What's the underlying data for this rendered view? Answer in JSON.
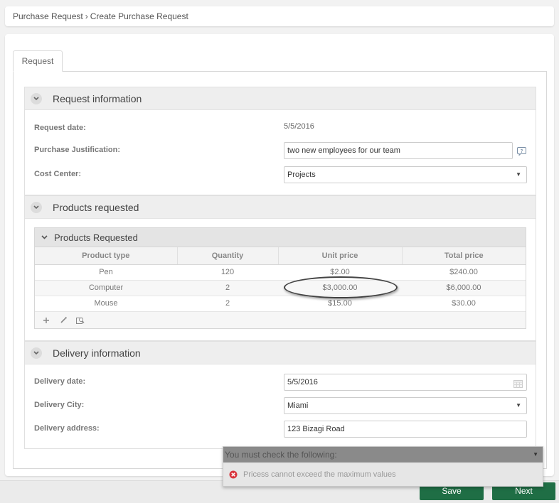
{
  "breadcrumb": {
    "parent": "Purchase Request",
    "separator": "›",
    "current": "Create Purchase Request"
  },
  "tabs": [
    {
      "label": "Request"
    }
  ],
  "request_info": {
    "title": "Request information",
    "request_date_label": "Request date:",
    "request_date_value": "5/5/2016",
    "justification_label": "Purchase Justification:",
    "justification_value": "two new employees for our team",
    "cost_center_label": "Cost Center:",
    "cost_center_value": "Projects"
  },
  "products_section": {
    "title": "Products requested",
    "grid_title": "Products Requested",
    "columns": [
      "Product type",
      "Quantity",
      "Unit price",
      "Total price"
    ],
    "rows": [
      [
        "Pen",
        "120",
        "$2.00",
        "$240.00"
      ],
      [
        "Computer",
        "2",
        "$3,000.00",
        "$6,000.00"
      ],
      [
        "Mouse",
        "2",
        "$15.00",
        "$30.00"
      ]
    ]
  },
  "delivery": {
    "title": "Delivery information",
    "date_label": "Delivery date:",
    "date_value": "5/5/2016",
    "city_label": "Delivery City:",
    "city_value": "Miami",
    "address_label": "Delivery address:",
    "address_value": "123 Bizagi Road"
  },
  "validation": {
    "header": "You must check the following:",
    "message": "Pricess cannot exceed the maximum values"
  },
  "footer": {
    "save_label": "Save",
    "next_label": "Next"
  },
  "colors": {
    "primary_button": "#1f6e45",
    "error": "#d9363e"
  },
  "icons": [
    "chevron-down-icon",
    "help-icon",
    "calendar-icon",
    "add-icon",
    "edit-icon",
    "detail-icon",
    "error-icon",
    "caret-down-icon"
  ]
}
